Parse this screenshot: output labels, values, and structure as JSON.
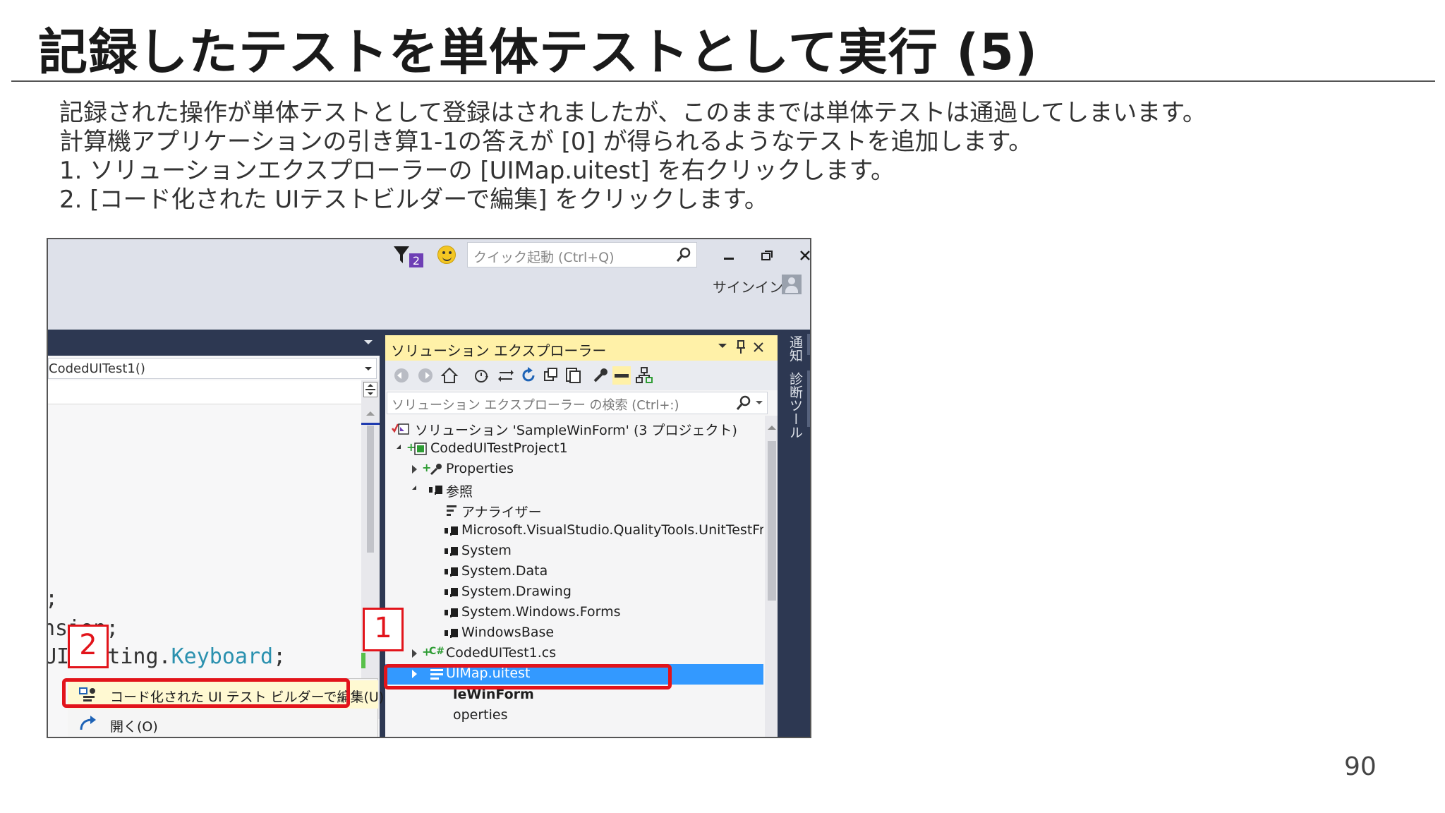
{
  "slide": {
    "title": "記録したテストを単体テストとして実行 (5)",
    "body_lines": [
      "記録された操作が単体テストとして登録はされましたが、このままでは単体テストは通過してしまいます。",
      "計算機アプリケーションの引き算1-1の答えが [0] が得られるようなテストを追加します。",
      "1.  ソリューションエクスプローラーの [UIMap.uitest] を右クリックします。",
      "2.  [コード化された UIテストビルダーで編集] をクリックします。"
    ],
    "page_number": "90"
  },
  "vs": {
    "notifications_count": "2",
    "quick_launch_placeholder": "クイック起動 (Ctrl+Q)",
    "signin_label": "サインイン",
    "member_combo_value": "CodedUITest1()",
    "code_lines": [
      ";",
      "nsion;",
      "UITesting.",
      "Keyboard",
      ";"
    ],
    "context_menu": {
      "edit_with_builder": "コード化された UI テスト ビルダーで編集(U)",
      "open": "開く(O)"
    },
    "solution_explorer": {
      "title": "ソリューション エクスプローラー",
      "search_placeholder": "ソリューション エクスプローラー の検索 (Ctrl+:)",
      "tree": {
        "solution": "ソリューション 'SampleWinForm' (3 プロジェクト)",
        "project": "CodedUITestProject1",
        "properties": "Properties",
        "references": "参照",
        "analyzer": "アナライザー",
        "ref_unittest": "Microsoft.VisualStudio.QualityTools.UnitTestFr",
        "ref_system": "System",
        "ref_system_data": "System.Data",
        "ref_system_drawing": "System.Drawing",
        "ref_system_windows_forms": "System.Windows.Forms",
        "ref_windowsbase": "WindowsBase",
        "codeduitest_cs": "CodedUITest1.cs",
        "uimap": "UIMap.uitest",
        "winform": "leWinForm",
        "properties2": "operties"
      }
    },
    "rail": {
      "notifications": "通知",
      "diagnostics": "診断ツール"
    }
  },
  "callouts": {
    "one": "1",
    "two": "2"
  },
  "colors": {
    "highlight_red": "#e2141b",
    "selection_blue": "#3399ff",
    "se_title_yellow": "#fff1a8",
    "vs_navy": "#2d3852"
  }
}
